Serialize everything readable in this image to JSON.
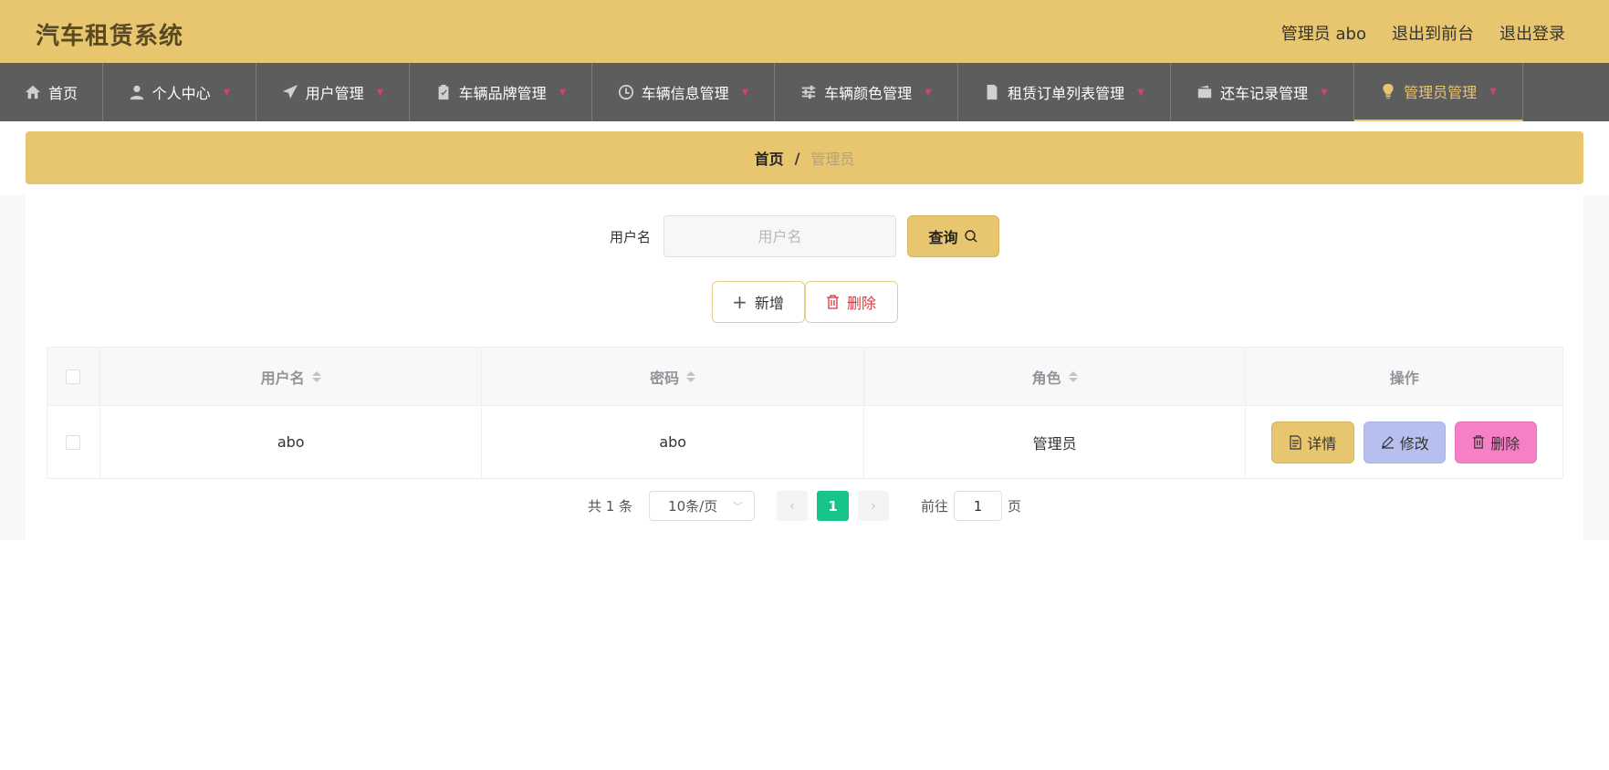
{
  "header": {
    "title": "汽车租赁系统",
    "user_label": "管理员 abo",
    "front_label": "退出到前台",
    "logout_label": "退出登录"
  },
  "nav": {
    "items": [
      {
        "label": "首页",
        "icon": "home-icon"
      },
      {
        "label": "个人中心",
        "icon": "person-icon"
      },
      {
        "label": "用户管理",
        "icon": "paper-plane-icon"
      },
      {
        "label": "车辆品牌管理",
        "icon": "clipboard-check-icon"
      },
      {
        "label": "车辆信息管理",
        "icon": "clock-icon"
      },
      {
        "label": "车辆颜色管理",
        "icon": "sliders-icon"
      },
      {
        "label": "租赁订单列表管理",
        "icon": "document-x-icon"
      },
      {
        "label": "还车记录管理",
        "icon": "wallet-icon"
      },
      {
        "label": "管理员管理",
        "icon": "lightbulb-icon"
      }
    ],
    "active_color": "#e8c56f",
    "accent_chevron_color": "#c9486a"
  },
  "breadcrumb": {
    "home": "首页",
    "separator": "/",
    "current": "管理员"
  },
  "search": {
    "label": "用户名",
    "placeholder": "用户名",
    "button_label": "查询"
  },
  "actions": {
    "add_label": "新增",
    "delete_label": "删除"
  },
  "table": {
    "columns": [
      "用户名",
      "密码",
      "角色",
      "操作"
    ],
    "rows": [
      {
        "username": "abo",
        "password": "abo",
        "role": "管理员"
      }
    ],
    "row_actions": {
      "detail": "详情",
      "edit": "修改",
      "delete": "删除"
    }
  },
  "pagination": {
    "total": "共 1 条",
    "page_size": "10条/页",
    "current_page": "1",
    "goto_label": "前往",
    "goto_value": "1",
    "page_suffix": "页"
  },
  "colors": {
    "brand": "#e8c56f",
    "nav_bg": "#5d5d5d",
    "page_active": "#17c48a",
    "edit_button": "#b6bfee",
    "delete_button": "#f580c6"
  }
}
